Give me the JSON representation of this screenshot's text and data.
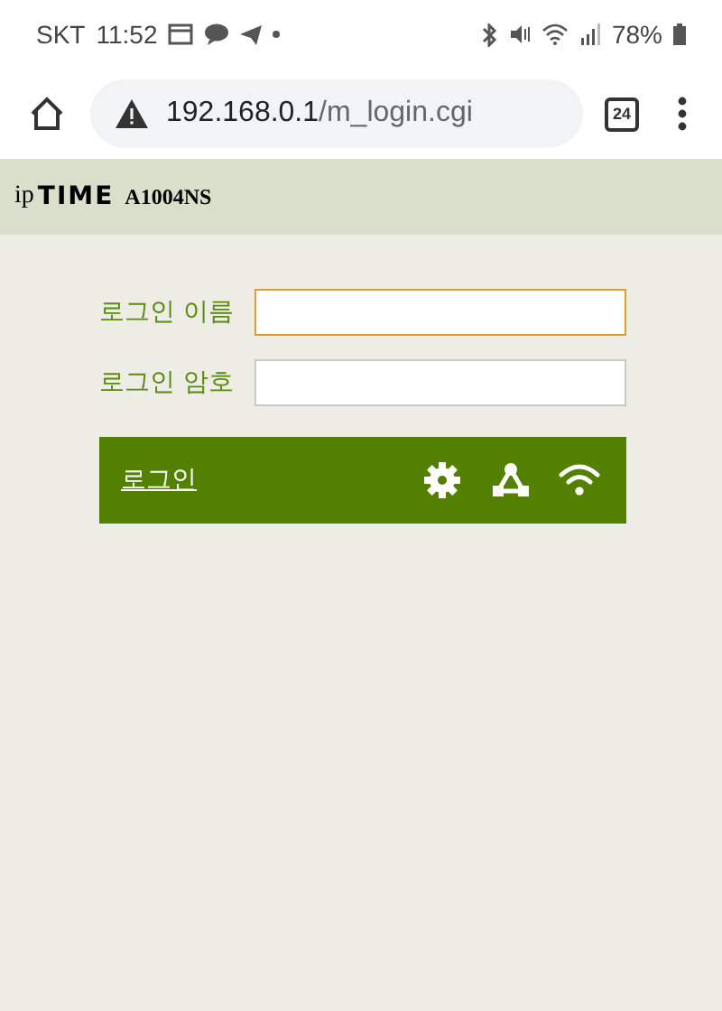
{
  "status_bar": {
    "carrier": "SKT",
    "time": "11:52",
    "battery": "78%"
  },
  "browser": {
    "url_host": "192.168.0.1",
    "url_path": "/m_login.cgi",
    "tab_count": "24"
  },
  "header": {
    "logo_prefix": "ip",
    "logo_brand": "TIME",
    "model": "A1004NS"
  },
  "form": {
    "fields": [
      {
        "label": "로그인 이름",
        "focused": true
      },
      {
        "label": "로그인 암호",
        "focused": false
      }
    ],
    "login_link": "로그인"
  }
}
